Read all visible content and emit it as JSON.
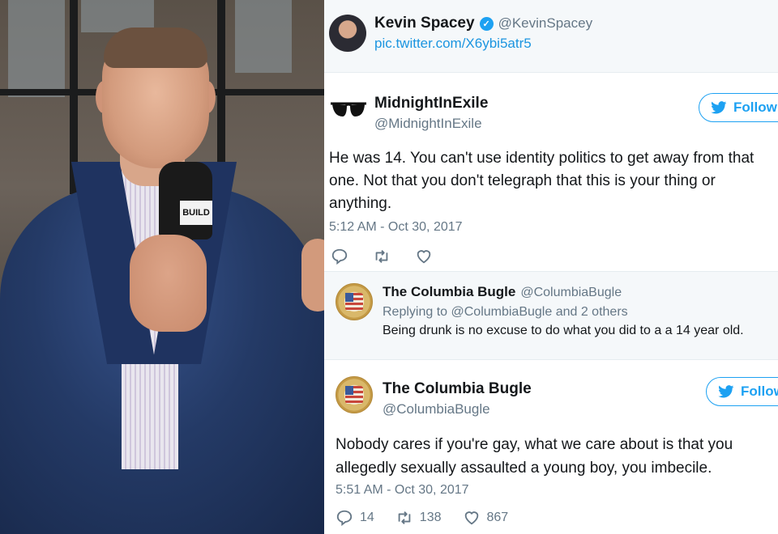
{
  "quoted_tweet": {
    "name": "Kevin Spacey",
    "handle": "@KevinSpacey",
    "link": "pic.twitter.com/X6ybi5atr5",
    "verified_icon": "verified-badge-icon"
  },
  "tweet1": {
    "name": "MidnightInExile",
    "handle": "@MidnightInExile",
    "follow_label": "Follow",
    "body": "He was 14. You can't use identity politics to get away from that one. Not that you don't telegraph that this is your thing or anything.",
    "time": "5:12 AM - Oct 30, 2017",
    "avatar_icon": "sunglasses-icon"
  },
  "reply": {
    "name": "The Columbia Bugle",
    "handle": "@ColumbiaBugle",
    "replying": "Replying to @ColumbiaBugle and 2 others",
    "text": "Being drunk is no excuse to do what you did to a a 14 year old."
  },
  "tweet2": {
    "name": "The Columbia Bugle",
    "handle": "@ColumbiaBugle",
    "follow_label": "Follow",
    "body": "Nobody cares if you're gay, what we care about is that you allegedly sexually assaulted a young boy, you imbecile.",
    "time": "5:51 AM - Oct 30, 2017",
    "replies": "14",
    "retweets": "138",
    "likes": "867"
  },
  "photo": {
    "mic_flag": "BUILD"
  },
  "colors": {
    "twitter_blue": "#1da1f2",
    "link_blue": "#1b95e0",
    "muted_gray": "#657786",
    "panel_gray": "#f5f8fa"
  }
}
